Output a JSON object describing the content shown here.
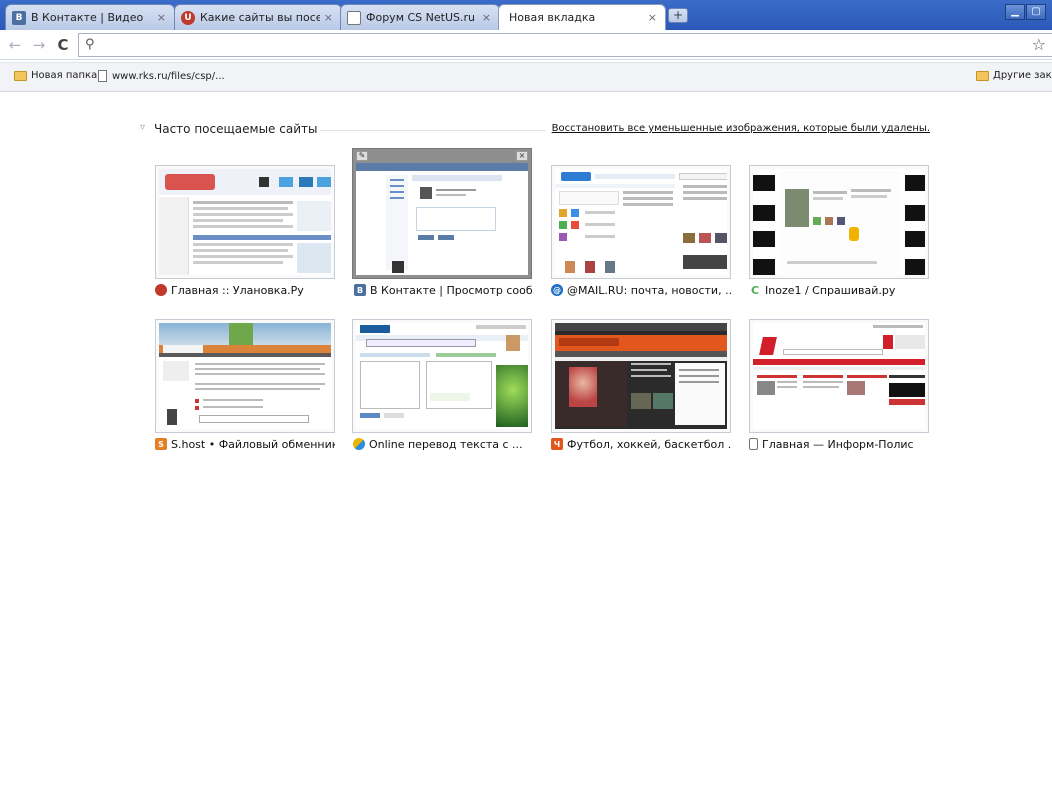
{
  "tabs": [
    {
      "label": "В Контакте | Видео",
      "favicon": "vk-icon"
    },
    {
      "label": "Какие сайты вы посещае...",
      "favicon": "ulanovka-icon"
    },
    {
      "label": "Форум CS NetUS.ru",
      "favicon": "page-icon"
    },
    {
      "label": "Новая вкладка",
      "favicon": "none"
    }
  ],
  "close_glyph": "×",
  "new_tab_glyph": "+",
  "window_buttons": {
    "minimize": "▁",
    "maximize": "▢"
  },
  "toolbar": {
    "back": "←",
    "forward": "→",
    "reload": "C",
    "address_value": "",
    "address_placeholder": "",
    "star": "☆"
  },
  "bookmarks": {
    "items": [
      {
        "label": "Новая папка",
        "type": "folder"
      },
      {
        "label": "www.rks.ru/files/csp/...",
        "type": "page"
      }
    ],
    "other": "Другие заклад"
  },
  "most_visited": {
    "title": "Часто посещаемые сайты",
    "collapse_glyph": "▿",
    "restore_link": "Восстановить все уменьшенные изображения, которые были удалены.",
    "tiles": [
      {
        "caption": "Главная :: Улановка.Ру",
        "favicon": "ulanovka-icon",
        "fav_color": "#c0392b"
      },
      {
        "caption": "В Контакте | Просмотр сооб...",
        "favicon": "vk-icon",
        "fav_color": "#4a6fa0"
      },
      {
        "caption": "@MAIL.RU: почта, новости, ...",
        "favicon": "mail-ru-icon",
        "fav_color": "#1f6fc8"
      },
      {
        "caption": "Inoze1 / Спрашивай.ру",
        "favicon": "sprashivai-icon",
        "fav_color": "#4caf50"
      },
      {
        "caption": "S.host • Файловый обменник",
        "favicon": "shost-icon",
        "fav_color": "#e67e22"
      },
      {
        "caption": "Online перевод текста с ...",
        "favicon": "translate-icon",
        "fav_color": "#8bc34a"
      },
      {
        "caption": "Футбол, хоккей, баскетбол ...",
        "favicon": "championat-icon",
        "fav_color": "#e2571e"
      },
      {
        "caption": "Главная — Информ-Полис",
        "favicon": "page-icon",
        "fav_color": "#ffffff"
      }
    ]
  },
  "colors": {
    "tabstrip": "#2a58b8",
    "vk_blue": "#4a6fa0",
    "championat_orange": "#e2571e",
    "inform_red": "#d21f2b"
  }
}
